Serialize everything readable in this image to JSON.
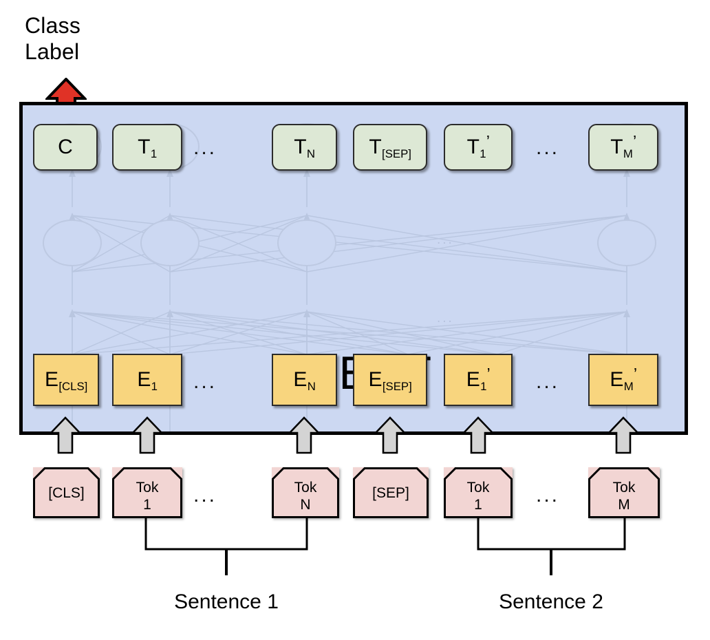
{
  "diagram": {
    "title_text": "Class\nLabel",
    "model_name": "BERT",
    "colors": {
      "model_block_fill": "#ccd8f2",
      "output_box_fill": "#dde8d5",
      "embedding_box_fill": "#f8d57e",
      "token_box_fill": "#f2d5d3",
      "classifier_arrow": "#e03226",
      "input_arrow": "#d4d4d4",
      "outline": "#000000"
    },
    "ellipsis": "...",
    "output_row": {
      "name": "final-hidden-representations",
      "cells": [
        {
          "id": "cls-output",
          "base": "C",
          "sub": "",
          "prime": false
        },
        {
          "id": "tok1-output",
          "base": "T",
          "sub": "1",
          "prime": false
        },
        {
          "id": "tokN-output",
          "base": "T",
          "sub": "N",
          "prime": false
        },
        {
          "id": "sep-output",
          "base": "T",
          "sub": "[SEP]",
          "prime": false
        },
        {
          "id": "tok1b-output",
          "base": "T",
          "sub": "1",
          "prime": true
        },
        {
          "id": "tokMb-output",
          "base": "T",
          "sub": "M",
          "prime": true
        }
      ]
    },
    "embedding_row": {
      "name": "input-embeddings",
      "cells": [
        {
          "id": "cls-embedding",
          "base": "E",
          "sub": "[CLS]",
          "prime": false
        },
        {
          "id": "tok1-embedding",
          "base": "E",
          "sub": "1",
          "prime": false
        },
        {
          "id": "tokN-embedding",
          "base": "E",
          "sub": "N",
          "prime": false
        },
        {
          "id": "sep-embedding",
          "base": "E",
          "sub": "[SEP]",
          "prime": false
        },
        {
          "id": "tok1b-embedding",
          "base": "E",
          "sub": "1",
          "prime": true
        },
        {
          "id": "tokMb-embedding",
          "base": "E",
          "sub": "M",
          "prime": true
        }
      ]
    },
    "token_row": {
      "name": "input-tokens",
      "cells": [
        {
          "id": "cls-token",
          "text": "[CLS]"
        },
        {
          "id": "tok1-token",
          "text": "Tok\n1"
        },
        {
          "id": "tokN-token",
          "text": "Tok\nN"
        },
        {
          "id": "sep-token",
          "text": "[SEP]"
        },
        {
          "id": "tok1b-token",
          "text": "Tok\n1"
        },
        {
          "id": "tokMb-token",
          "text": "Tok\nM"
        }
      ]
    },
    "sentence_labels": [
      {
        "id": "sentence-1",
        "text": "Sentence 1"
      },
      {
        "id": "sentence-2",
        "text": "Sentence 2"
      }
    ]
  }
}
